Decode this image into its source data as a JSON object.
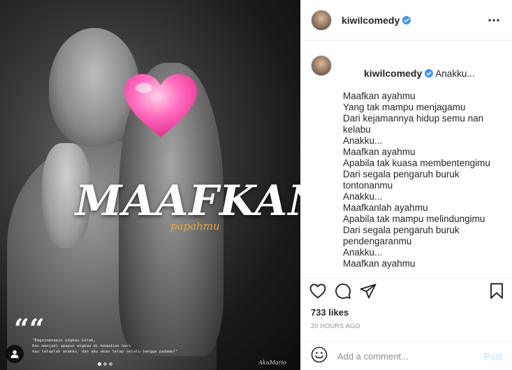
{
  "post": {
    "username": "kiwilcomedy",
    "verified": true,
    "more_icon": "more-horizontal-icon"
  },
  "media": {
    "title": "MAAFKAN",
    "subtitle": "papahmu",
    "quote_mark": "““",
    "quote_lines": [
      "\"Bagaimanapun engkau kelak,",
      "Dan menjadi apapun engkau di kemudian hari",
      "kau tetaplah anakku, dan aku akan tetap selalu bangga padamu!\""
    ],
    "signature": "AkuMario",
    "carousel_count": 3,
    "carousel_active": 0
  },
  "caption": {
    "username": "kiwilcomedy",
    "first_line": "Anakku...",
    "lines": [
      "Maafkan ayahmu",
      "Yang tak mampu menjagamu",
      "Dari kejamannya hidup semu nan",
      "kelabu",
      "",
      "Anakku...",
      "Maafkan ayahmu",
      "Apabila tak kuasa membentengimu",
      "Dari segala pengaruh buruk",
      "tontonanmu",
      "",
      "Anakku...",
      "Maafkanlah ayahmu",
      "Apabila tak mampu melindungimu",
      "Dari segala pengaruh buruk",
      "pendengaranmu",
      "",
      "Anakku...",
      "Maafkan ayahmu"
    ]
  },
  "engagement": {
    "likes": "733 likes",
    "timestamp": "20 HOURS AGO"
  },
  "comment": {
    "placeholder": "Add a comment...",
    "post_label": "Post"
  },
  "colors": {
    "verified": "#3897f0",
    "post_button_disabled": "#b2dffc",
    "subtitle_orange": "#e6a64a",
    "heart_pink": "#ff5db1"
  }
}
